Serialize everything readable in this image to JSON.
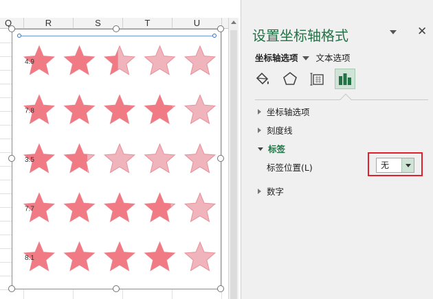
{
  "sheet": {
    "columns": [
      "Q",
      "R",
      "S",
      "T",
      "U"
    ]
  },
  "chart_data": {
    "type": "bar",
    "categories": [
      "4.9",
      "7.8",
      "3.5",
      "7.7",
      "8.1"
    ],
    "values": [
      4.9,
      7.8,
      3.5,
      7.7,
      8.1
    ],
    "max_stars": 5,
    "star_unit": 2,
    "colors": {
      "filled": "#f07b84",
      "empty": "#efb4bc",
      "outline": "#e8909a"
    }
  },
  "pane": {
    "title": "设置坐标轴格式",
    "close_glyph": "✕",
    "tab_axis_options": "坐标轴选项",
    "tab_text_options": "文本选项",
    "icons": [
      "paint-bucket-icon",
      "pentagon-icon",
      "size-properties-icon",
      "bar-chart-icon"
    ],
    "sections": {
      "axis_options": "坐标轴选项",
      "tick_marks": "刻度线",
      "labels": "标签",
      "number": "数字"
    },
    "label_position": {
      "label": "标签位置(L)",
      "value": "无"
    },
    "accent_color": "#217346",
    "highlight_color": "#e0202a"
  }
}
